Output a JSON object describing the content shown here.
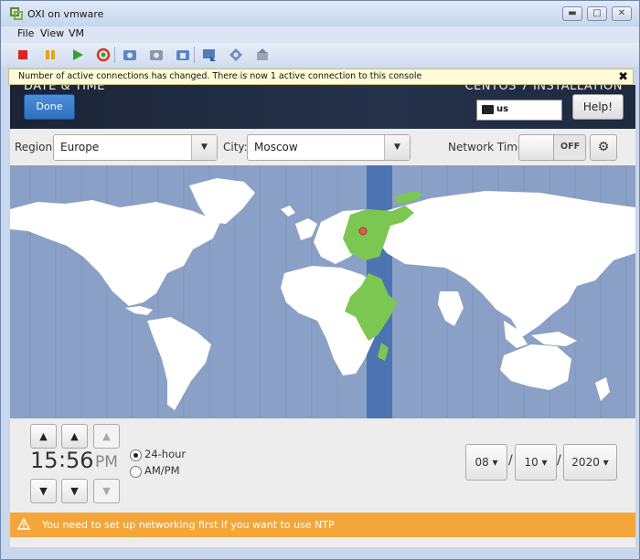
{
  "window": {
    "title": "OXI on vmware",
    "controls": {
      "minimize": "▬",
      "maximize": "□",
      "close": "✕"
    }
  },
  "menu": [
    "File",
    "View",
    "VM"
  ],
  "toolbar": {
    "icons": [
      "power-off-icon",
      "suspend-icon",
      "power-on-icon",
      "reset-icon",
      "snapshot-icon",
      "revert-icon",
      "manage-snapshots-icon",
      "fullscreen-icon",
      "unity-icon",
      "send-keys-icon"
    ]
  },
  "notice": {
    "text": "Number of active connections has changed. There is now 1 active connection to this console",
    "close": "✖"
  },
  "header": {
    "title": "DATE & TIME",
    "distro": "CENTOS 7 INSTALLATION",
    "done": "Done",
    "keyboard": "us",
    "help": "Help!"
  },
  "region": {
    "region_label": "Region:",
    "region_value": "Europe",
    "city_label": "City:",
    "city_value": "Moscow",
    "network_time_label": "Network Time",
    "network_time_state": "OFF",
    "dropdown_arrow": "▼"
  },
  "map": {
    "selected_city": "Moscow",
    "colors": {
      "ocean": "#8aa0c6",
      "land": "#ffffff",
      "selected_zone": "#7cc752",
      "timezone_band": "#4d74b2",
      "pin": "#e05a4e"
    }
  },
  "time": {
    "hour": "15",
    "separator": ":",
    "minute": "56",
    "ampm": "PM",
    "format_24": "24-hour",
    "format_ampm": "AM/PM",
    "selected_format": "24-hour",
    "up_arrow": "▲",
    "down_arrow": "▼"
  },
  "date": {
    "month": "08 ▾",
    "day": "10 ▾",
    "year": "2020 ▾",
    "separator": "/"
  },
  "warning": {
    "text": "You need to set up networking first if you want to use NTP",
    "color": "#f5a63b"
  }
}
